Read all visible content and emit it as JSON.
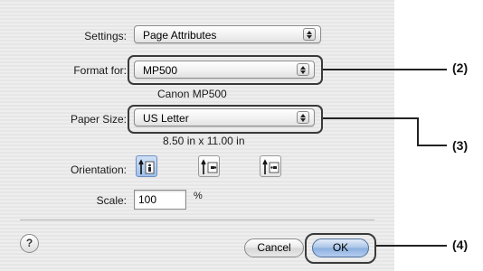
{
  "settings": {
    "label": "Settings:",
    "value": "Page Attributes"
  },
  "format_for": {
    "label": "Format for:",
    "value": "MP500",
    "subtitle": "Canon MP500"
  },
  "paper_size": {
    "label": "Paper Size:",
    "value": "US Letter",
    "dimensions": "8.50 in x 11.00 in"
  },
  "orientation": {
    "label": "Orientation:",
    "options": [
      "portrait",
      "landscape",
      "landscape-reversed"
    ],
    "selected": "portrait"
  },
  "scale": {
    "label": "Scale:",
    "value": "100",
    "unit": "%"
  },
  "buttons": {
    "help": "?",
    "cancel": "Cancel",
    "ok": "OK"
  },
  "callouts": [
    "(2)",
    "(3)",
    "(4)"
  ],
  "colors": {
    "default_button": "#8aafdf",
    "dialog_bg": "#ececec",
    "callout": "#222222"
  }
}
